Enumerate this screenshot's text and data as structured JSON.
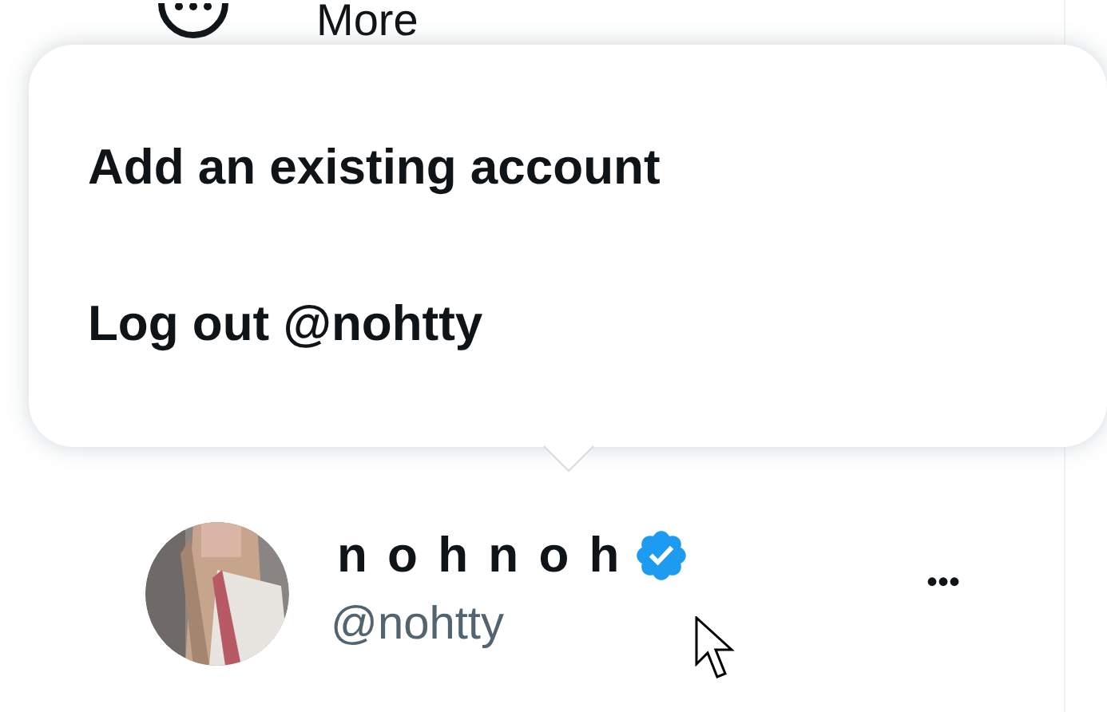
{
  "nav_item": {
    "label": "More"
  },
  "menu": {
    "items": [
      {
        "label": "Add an existing account"
      },
      {
        "label": "Log out @nohtty"
      }
    ]
  },
  "account": {
    "name": "n o h n o h",
    "verified": true,
    "handle": "@nohtty",
    "more": "•••"
  }
}
